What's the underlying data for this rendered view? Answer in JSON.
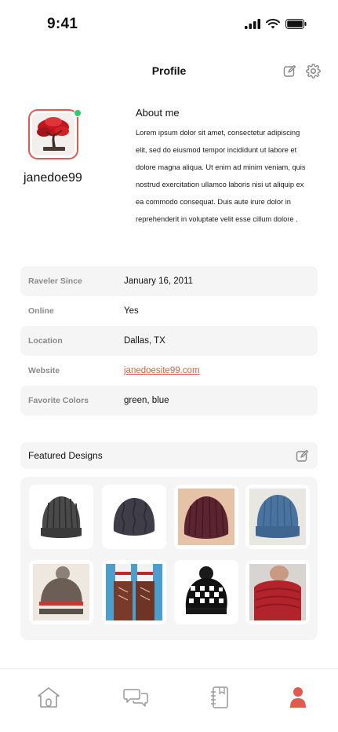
{
  "status_bar": {
    "time": "9:41"
  },
  "header": {
    "title": "Profile"
  },
  "profile": {
    "username": "janedoe99",
    "online": true,
    "about_title": "About me",
    "about_text": "Lorem ipsum dolor sit amet, consectetur adipiscing elit, sed do eiusmod tempor incididunt ut labore et dolore magna aliqua. Ut enim ad minim veniam, quis nostrud exercitation ullamco laboris nisi ut aliquip ex ea commodo consequat. Duis aute irure dolor in reprehenderit in voluptate velit esse cillum dolore ."
  },
  "info": [
    {
      "label": "Raveler Since",
      "value": "January 16, 2011"
    },
    {
      "label": "Online",
      "value": "Yes"
    },
    {
      "label": "Location",
      "value": "Dallas, TX"
    },
    {
      "label": "Website",
      "value": "janedoesite99.com"
    },
    {
      "label": "Favorite Colors",
      "value": "green, blue"
    }
  ],
  "featured": {
    "title": "Featured Designs",
    "designs": [
      {
        "name": "Gray ribbed beanie",
        "icon": "hat-icon",
        "color": "#4a4a4a"
      },
      {
        "name": "Charcoal cable beanie",
        "icon": "hat-icon",
        "color": "#3e3d48"
      },
      {
        "name": "Burgundy ribbed beanie",
        "icon": "hat-icon",
        "color": "#5c2430"
      },
      {
        "name": "Blue ribbed beanie",
        "icon": "hat-icon",
        "color": "#4a73a0"
      },
      {
        "name": "Striped pom-pom hat",
        "icon": "hat-icon",
        "color": "#6a5e55"
      },
      {
        "name": "Boot socks",
        "icon": "sock-icon",
        "color": "#7a3a2a"
      },
      {
        "name": "Houndstooth pom-pom hat",
        "icon": "hat-icon",
        "color": "#111111"
      },
      {
        "name": "Red cowl",
        "icon": "cowl-icon",
        "color": "#b3232b"
      }
    ]
  },
  "nav": {
    "items": [
      {
        "name": "home",
        "icon": "home-icon",
        "active": false
      },
      {
        "name": "messages",
        "icon": "chat-icon",
        "active": false
      },
      {
        "name": "notebook",
        "icon": "notebook-icon",
        "active": false
      },
      {
        "name": "profile",
        "icon": "user-icon",
        "active": true
      }
    ]
  },
  "colors": {
    "accent": "#e05a4f",
    "online": "#2ecc71",
    "muted": "#8a8a8a",
    "panel": "#f5f5f5"
  }
}
